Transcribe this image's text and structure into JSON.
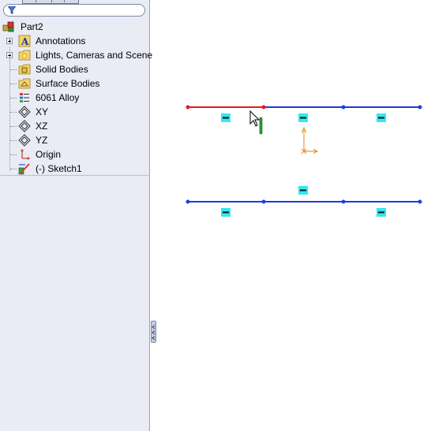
{
  "filter": {
    "icon": "filter-icon"
  },
  "tree": {
    "root": "Part2",
    "items": [
      {
        "label": "Annotations",
        "icon": "annotations-icon",
        "expandable": true
      },
      {
        "label": "Lights, Cameras and Scene",
        "icon": "lights-icon",
        "expandable": true
      },
      {
        "label": "Solid Bodies",
        "icon": "solid-bodies-icon",
        "expandable": false
      },
      {
        "label": "Surface Bodies",
        "icon": "surface-bodies-icon",
        "expandable": false
      },
      {
        "label": "6061 Alloy",
        "icon": "material-icon",
        "expandable": false
      },
      {
        "label": "XY",
        "icon": "plane-icon",
        "expandable": false
      },
      {
        "label": "XZ",
        "icon": "plane-icon",
        "expandable": false
      },
      {
        "label": "YZ",
        "icon": "plane-icon",
        "expandable": false
      },
      {
        "label": "Origin",
        "icon": "origin-icon",
        "expandable": false
      },
      {
        "label": "(-) Sketch1",
        "icon": "sketch-icon",
        "expandable": false
      }
    ]
  },
  "colors": {
    "selected_line": "#e01c1c",
    "sketch_line": "#1e3ad6",
    "endpoint": "#1d3fe0",
    "relation_badge": "#34e8f0",
    "origin": "#e08a1a",
    "cursor_bar": "#2aa12a"
  }
}
